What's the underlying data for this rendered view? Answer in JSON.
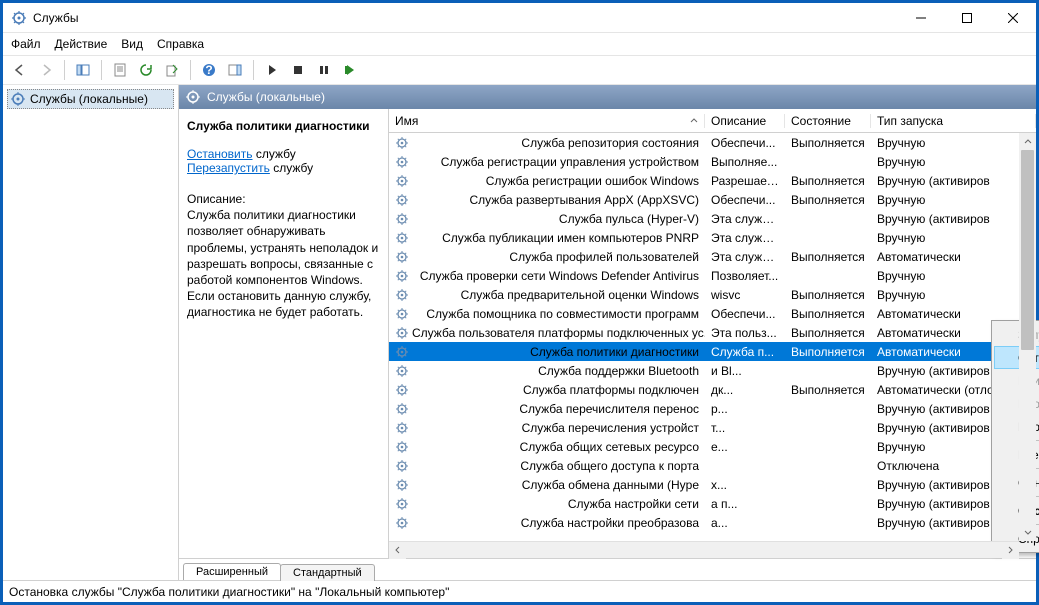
{
  "window": {
    "title": "Службы"
  },
  "menu": {
    "file": "Файл",
    "action": "Действие",
    "view": "Вид",
    "help": "Справка"
  },
  "tree": {
    "root": "Службы (локальные)"
  },
  "paneHeader": "Службы (локальные)",
  "detail": {
    "serviceName": "Служба политики диагностики",
    "stopLink": "Остановить",
    "stopSuffix": " службу",
    "restartLink": "Перезапустить",
    "restartSuffix": " службу",
    "descLabel": "Описание:",
    "descText": "Служба политики диагностики позволяет обнаруживать проблемы, устранять неполадок и разрешать вопросы, связанные с работой компонентов Windows. Если остановить данную службу, диагностика не будет работать."
  },
  "columns": {
    "name": "Имя",
    "desc": "Описание",
    "state": "Состояние",
    "start": "Тип запуска"
  },
  "services": [
    {
      "name": "Служба репозитория состояния",
      "desc": "Обеспечи...",
      "state": "Выполняется",
      "start": "Вручную"
    },
    {
      "name": "Служба регистрации управления устройством",
      "desc": "Выполняе...",
      "state": "",
      "start": "Вручную"
    },
    {
      "name": "Служба регистрации ошибок Windows",
      "desc": "Разрешает...",
      "state": "Выполняется",
      "start": "Вручную (активиров"
    },
    {
      "name": "Служба развертывания AppX (AppXSVC)",
      "desc": "Обеспечи...",
      "state": "Выполняется",
      "start": "Вручную"
    },
    {
      "name": "Служба пульса (Hyper-V)",
      "desc": "Эта служб...",
      "state": "",
      "start": "Вручную (активиров"
    },
    {
      "name": "Служба публикации имен компьютеров PNRP",
      "desc": "Эта служб...",
      "state": "",
      "start": "Вручную"
    },
    {
      "name": "Служба профилей пользователей",
      "desc": "Эта служб...",
      "state": "Выполняется",
      "start": "Автоматически"
    },
    {
      "name": "Служба проверки сети Windows Defender Antivirus",
      "desc": "Позволяет...",
      "state": "",
      "start": "Вручную"
    },
    {
      "name": "Служба предварительной оценки Windows",
      "desc": "wisvc",
      "state": "Выполняется",
      "start": "Вручную"
    },
    {
      "name": "Служба помощника по совместимости программ",
      "desc": "Обеспечи...",
      "state": "Выполняется",
      "start": "Автоматически"
    },
    {
      "name": "Служба пользователя платформы подключенных ус...",
      "desc": "Эта польз...",
      "state": "Выполняется",
      "start": "Автоматически"
    },
    {
      "name": "Служба политики диагностики",
      "desc": "Служба п...",
      "state": "Выполняется",
      "start": "Автоматически",
      "sel": true
    },
    {
      "name": "Служба поддержки Bluetooth",
      "desc": "и Bl...",
      "state": "",
      "start": "Вручную (активиров"
    },
    {
      "name": "Служба платформы подключен",
      "desc": "дк...",
      "state": "Выполняется",
      "start": "Автоматически (отло"
    },
    {
      "name": "Служба перечислителя перенос",
      "desc": "р...",
      "state": "",
      "start": "Вручную (активиров"
    },
    {
      "name": "Служба перечисления устройст",
      "desc": "т...",
      "state": "",
      "start": "Вручную (активиров"
    },
    {
      "name": "Служба общих сетевых ресурсо",
      "desc": "е...",
      "state": "",
      "start": "Вручную"
    },
    {
      "name": "Служба общего доступа к порта",
      "desc": "",
      "state": "",
      "start": "Отключена"
    },
    {
      "name": "Служба обмена данными (Hype",
      "desc": "х...",
      "state": "",
      "start": "Вручную (активиров"
    },
    {
      "name": "Служба настройки сети",
      "desc": "а п...",
      "state": "",
      "start": "Вручную (активиров"
    },
    {
      "name": "Служба настройки преобразова",
      "desc": "а...",
      "state": "",
      "start": "Вручную (активиров"
    }
  ],
  "context": {
    "start": "Запустить",
    "stop": "Остановить",
    "pause": "Приостановить",
    "resume": "Продолжить",
    "restart": "Перезапустить",
    "allTasks": "Все задачи",
    "refresh": "Обновить",
    "properties": "Свойства",
    "help": "Справка"
  },
  "tabs": {
    "extended": "Расширенный",
    "standard": "Стандартный"
  },
  "status": "Остановка службы \"Служба политики диагностики\" на \"Локальный компьютер\""
}
